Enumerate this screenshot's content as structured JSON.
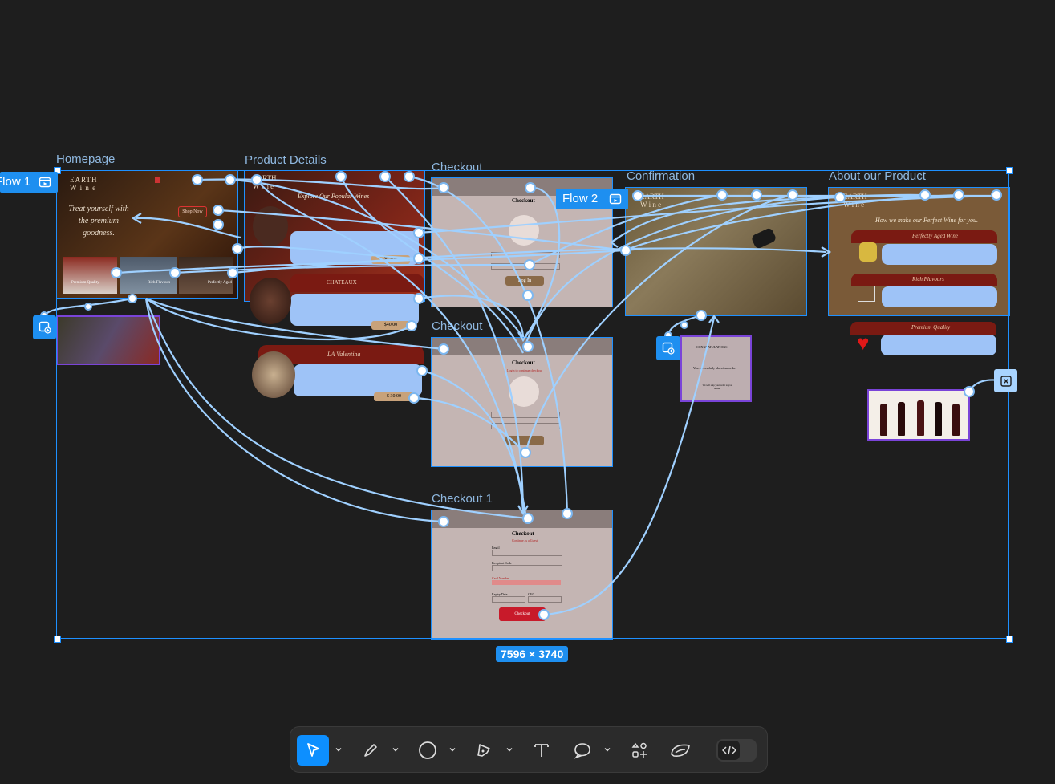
{
  "frames": {
    "homepage": {
      "label": "Homepage",
      "hero_text": "Treat yourself with the premium goodness.",
      "cta": "Shop Now",
      "brand": "EARTH",
      "brand_sub": "W i n e",
      "thumbs": [
        "Premium Quality",
        "Rich Flavours",
        "Perfectly Aged"
      ]
    },
    "product_details": {
      "label": "Product Details",
      "title": "Explore Our Popular Wines",
      "items": [
        {
          "name": "",
          "price": "$25.00"
        },
        {
          "name": "CHATEAUX",
          "price": "$40.00"
        },
        {
          "name": "LA Valentina",
          "price": "$ 30.00"
        }
      ],
      "brand": "EARTH",
      "brand_sub": "W i n e"
    },
    "checkout_a": {
      "label": "Checkout",
      "title": "Checkout",
      "button": "Log In",
      "brand": "EARTH",
      "brand_sub": "W i n e"
    },
    "checkout_b": {
      "label": "Checkout",
      "title": "Checkout",
      "subtitle": "Login to continue checkout",
      "brand": "EARTH",
      "brand_sub": "W i n e"
    },
    "checkout_1": {
      "label": "Checkout 1",
      "title": "Checkout",
      "subtitle": "Continue as a Guest",
      "fields": [
        "Email",
        "Recipient Code",
        "Card Number",
        "Expiry Date",
        "CVC"
      ],
      "button": "Checkout"
    },
    "confirmation": {
      "label": "Confirmation",
      "popup_title": "CONGRATULATIONS!",
      "popup_text": "You successfully placed an order.",
      "popup_sub": "We will ship your order to you ASAP.",
      "brand": "EARTH",
      "brand_sub": "W i n e"
    },
    "about": {
      "label": "About our Product",
      "heading": "How we make our Perfect Wine for you.",
      "sections": [
        "Perfectly Aged Wine",
        "Rich Flavours",
        "Premium Quality"
      ],
      "brand": "EARTH",
      "brand_sub": "W i n e"
    }
  },
  "flows": {
    "flow1": "Flow 1",
    "flow2": "Flow 2"
  },
  "selection": {
    "dimensions": "7596 × 3740"
  },
  "toolbar": {
    "tools": [
      "move-tool",
      "draw-tool",
      "shape-tool",
      "pen-tool",
      "text-tool",
      "comment-tool",
      "assets-tool",
      "plugin-tool",
      "dev-mode-toggle"
    ]
  },
  "colors": {
    "accent": "#1e8ff0",
    "canvas": "#1e1e1e",
    "wire": "#9fd0ff",
    "wine": "#7a1a12"
  }
}
